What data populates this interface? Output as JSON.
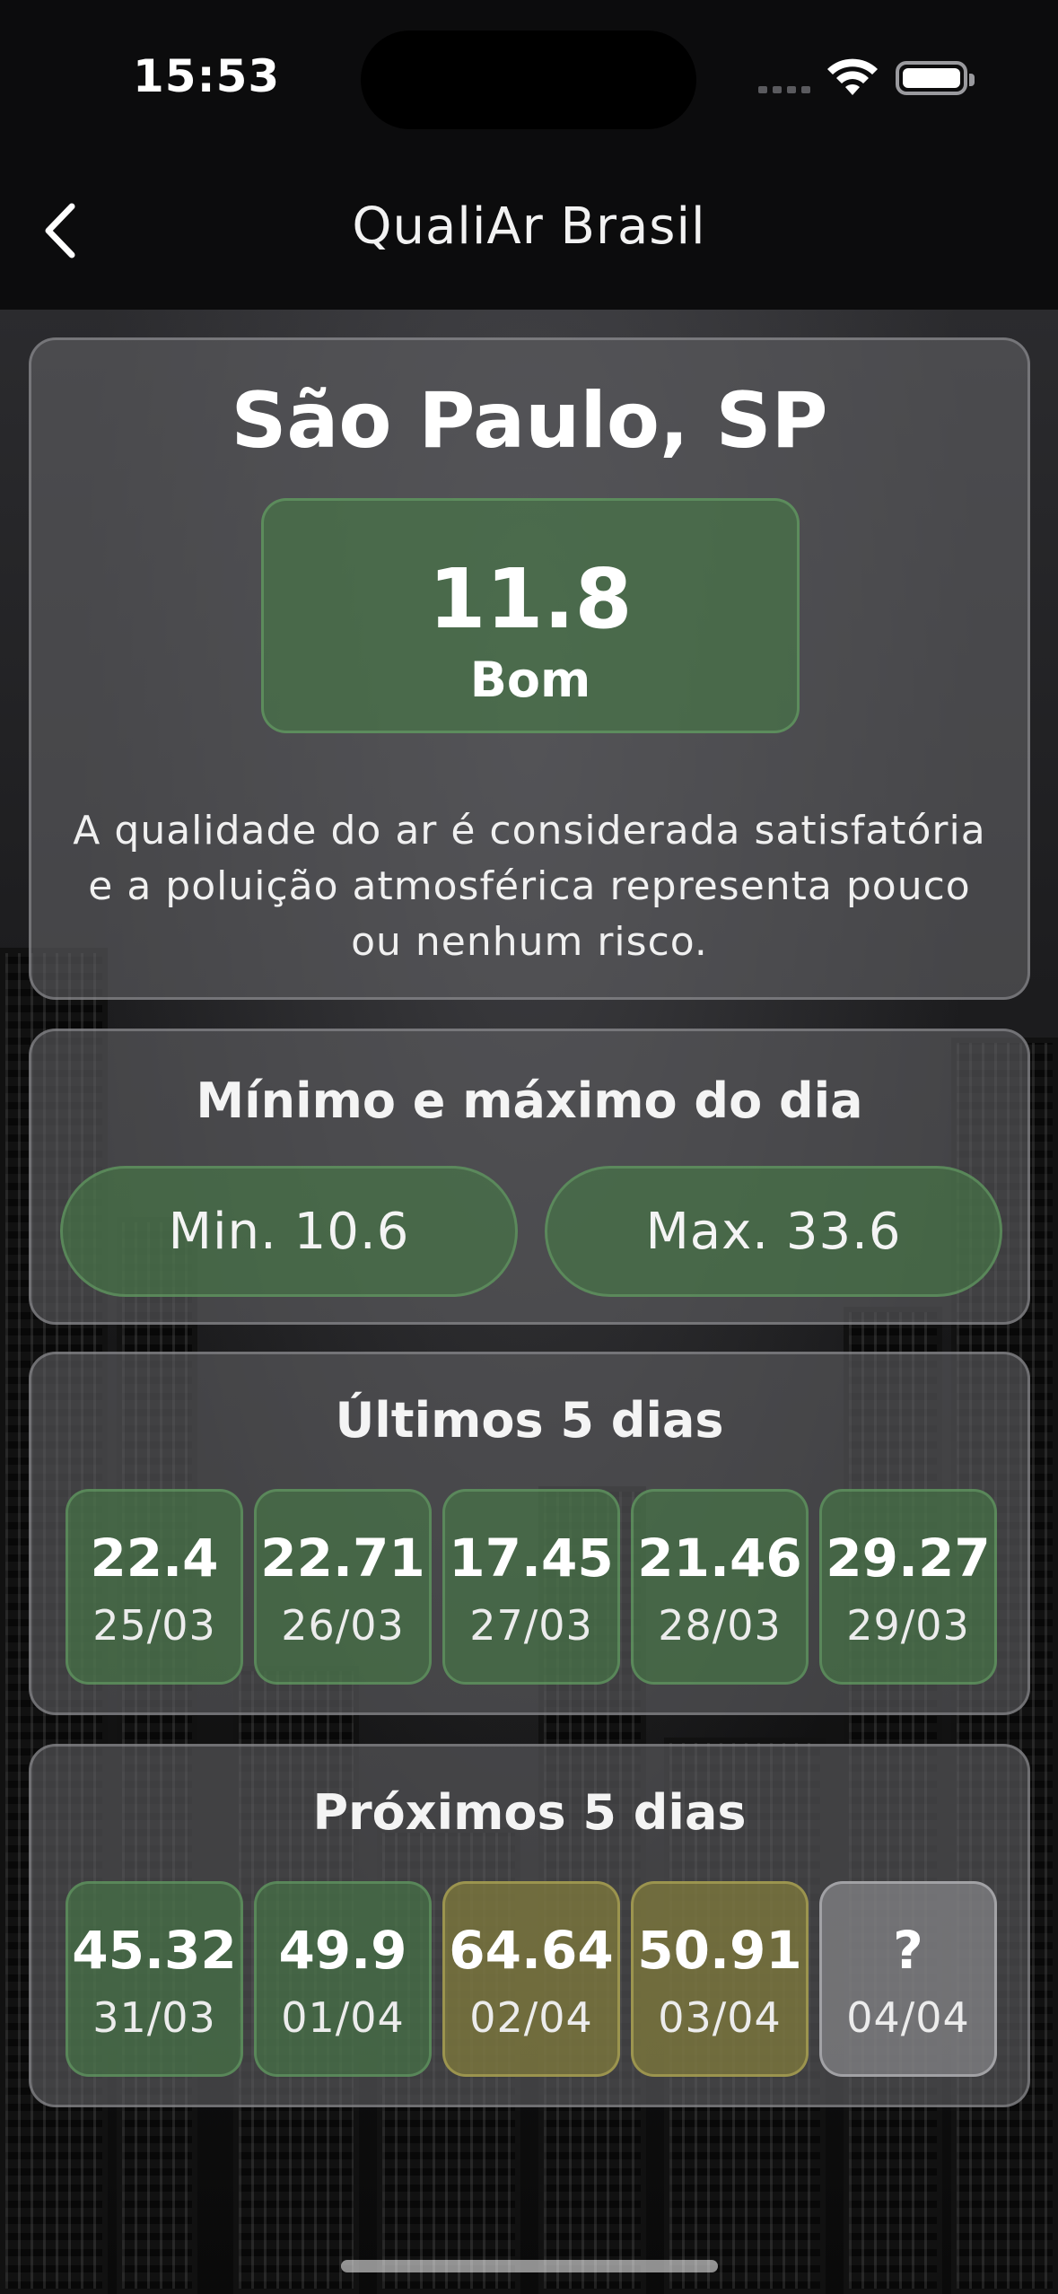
{
  "status_bar": {
    "time": "15:53"
  },
  "nav": {
    "title": "QualiAr Brasil",
    "back_icon": "chevron-left-icon"
  },
  "main": {
    "city": "São Paulo, SP",
    "aqi_value": "11.8",
    "aqi_label": "Bom",
    "description": "A qualidade do ar é considerada satisfatória e a poluição atmosférica representa pouco ou nenhum risco."
  },
  "minmax": {
    "title": "Mínimo e máximo do dia",
    "min_label": "Min. 10.6",
    "max_label": "Max. 33.6"
  },
  "past": {
    "title": "Últimos 5 dias",
    "days": [
      {
        "value": "22.4",
        "date": "25/03"
      },
      {
        "value": "22.71",
        "date": "26/03"
      },
      {
        "value": "17.45",
        "date": "27/03"
      },
      {
        "value": "21.46",
        "date": "28/03"
      },
      {
        "value": "29.27",
        "date": "29/03"
      }
    ]
  },
  "next": {
    "title": "Próximos 5 dias",
    "days": [
      {
        "value": "45.32",
        "date": "31/03"
      },
      {
        "value": "49.9",
        "date": "01/04"
      },
      {
        "value": "64.64",
        "date": "02/04"
      },
      {
        "value": "50.91",
        "date": "03/04"
      },
      {
        "value": "?",
        "date": "04/04"
      }
    ]
  },
  "colors": {
    "good": "#46784a",
    "moderate": "#827d3c",
    "unknown": "#87878a"
  }
}
